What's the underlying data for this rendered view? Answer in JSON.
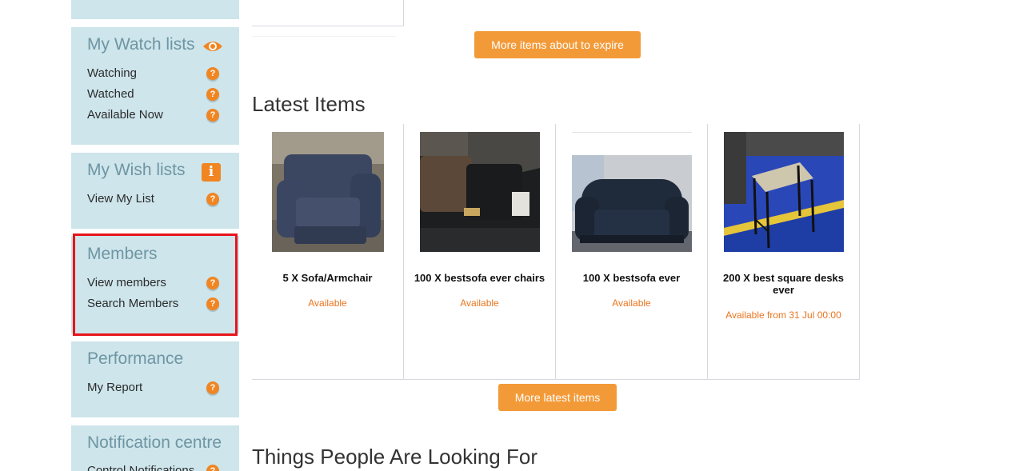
{
  "sidebar": {
    "watch": {
      "title": "My Watch lists",
      "icon": "eye-icon",
      "items": [
        {
          "label": "Watching"
        },
        {
          "label": "Watched"
        },
        {
          "label": "Available Now"
        }
      ]
    },
    "wish": {
      "title": "My Wish lists",
      "icon": "info-icon",
      "items": [
        {
          "label": "View My List"
        }
      ]
    },
    "members": {
      "title": "Members",
      "items": [
        {
          "label": "View members"
        },
        {
          "label": "Search Members"
        }
      ]
    },
    "performance": {
      "title": "Performance",
      "items": [
        {
          "label": "My Report"
        }
      ]
    },
    "notifications": {
      "title": "Notification centre",
      "items": [
        {
          "label": "Control Notifications"
        }
      ]
    },
    "help_glyph": "?",
    "info_glyph": "i"
  },
  "main": {
    "expire_button": "More items about to expire",
    "latest_title": "Latest Items",
    "items": [
      {
        "title": "5 X Sofa/Armchair",
        "status": "Available",
        "image": "armchair-photo"
      },
      {
        "title": "100 X bestsofa ever chairs",
        "status": "Available",
        "image": "chairs-photo"
      },
      {
        "title": "100 X bestsofa ever",
        "status": "Available",
        "image": "sofa-photo"
      },
      {
        "title": "200 X best square desks ever",
        "status": "Available from 31 Jul 00:00",
        "image": "desk-photo"
      }
    ],
    "latest_button": "More latest items",
    "looking_title": "Things People Are Looking For"
  },
  "colors": {
    "accent_orange": "#f39a38",
    "panel_bg": "#cde5eb",
    "panel_title": "#6f95a3",
    "highlight_red": "#e8141b",
    "status_orange": "#e8751f"
  }
}
